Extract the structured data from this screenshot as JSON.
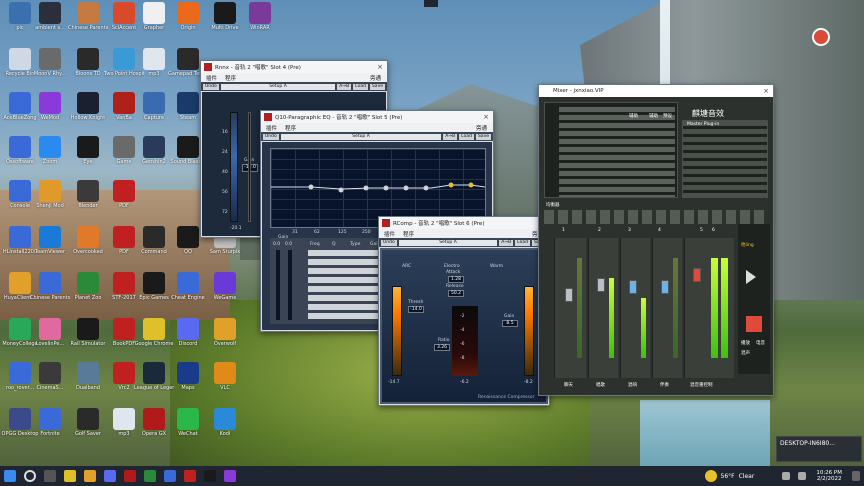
{
  "desktop": {
    "icons": [
      {
        "label": "pic",
        "color": "#3a6fb0",
        "col": 0,
        "row": 0
      },
      {
        "label": "ambient s...",
        "color": "#2b2f3a",
        "col": 1,
        "row": 0
      },
      {
        "label": "Chinese Parents",
        "color": "#c47a40",
        "col": 2,
        "row": 0
      },
      {
        "label": "SciAccent",
        "color": "#d84a2a",
        "col": 3,
        "row": 0
      },
      {
        "label": "Grapher",
        "color": "#f0f0f0",
        "col": 4,
        "row": 0
      },
      {
        "label": "Origin",
        "color": "#e86a1a",
        "col": 5,
        "row": 0
      },
      {
        "label": "Multi Drive",
        "color": "#1a1a1a",
        "col": 6,
        "row": 0
      },
      {
        "label": "WinRAR",
        "color": "#7a3a9a",
        "col": 7,
        "row": 0
      },
      {
        "label": "Recycle Bin",
        "color": "#cfd8e4",
        "col": 0,
        "row": 1
      },
      {
        "label": "MoonV Rhy...",
        "color": "#6a6a6a",
        "col": 1,
        "row": 1
      },
      {
        "label": "Bloons TD",
        "color": "#2a2a2a",
        "col": 2,
        "row": 1
      },
      {
        "label": "Two Point Hospital",
        "color": "#3a9ad8",
        "col": 3,
        "row": 1
      },
      {
        "label": "mp3",
        "color": "#e0e6ee",
        "col": 4,
        "row": 1
      },
      {
        "label": "Gamepad Tester",
        "color": "#2a2a2a",
        "col": 5,
        "row": 1
      },
      {
        "label": "AceBlueZong",
        "color": "#3a6ad8",
        "col": 0,
        "row": 2
      },
      {
        "label": "WeMod",
        "color": "#8a3ad8",
        "col": 1,
        "row": 2
      },
      {
        "label": "Hollow Knight",
        "color": "#1a2030",
        "col": 2,
        "row": 2
      },
      {
        "label": "VanBa",
        "color": "#b0201a",
        "col": 3,
        "row": 2
      },
      {
        "label": "Capture",
        "color": "#3a6ab0",
        "col": 4,
        "row": 2
      },
      {
        "label": "Steam",
        "color": "#1a3a6a",
        "col": 5,
        "row": 2
      },
      {
        "label": "Ossoftware",
        "color": "#3a6ad8",
        "col": 0,
        "row": 3
      },
      {
        "label": "Zoom",
        "color": "#2a8af0",
        "col": 1,
        "row": 3
      },
      {
        "label": "Eye",
        "color": "#1a1a1a",
        "col": 2,
        "row": 3
      },
      {
        "label": "Game",
        "color": "#6a6a6a",
        "col": 3,
        "row": 3
      },
      {
        "label": "Genshin2",
        "color": "#2a3a5a",
        "col": 4,
        "row": 3
      },
      {
        "label": "Sound Blaster",
        "color": "#1a1a1a",
        "col": 5,
        "row": 3
      },
      {
        "label": "Console",
        "color": "#3a6ad8",
        "col": 0,
        "row": 4
      },
      {
        "label": "Shenji Mod",
        "color": "#e09a2a",
        "col": 1,
        "row": 4
      },
      {
        "label": "Blender",
        "color": "#3a3a3a",
        "col": 2,
        "row": 4
      },
      {
        "label": "PDF",
        "color": "#c02020",
        "col": 3,
        "row": 4
      },
      {
        "label": "HLinstall2200",
        "color": "#3a6ad8",
        "col": 0,
        "row": 5
      },
      {
        "label": "TeamViewer",
        "color": "#1a7ad8",
        "col": 1,
        "row": 5
      },
      {
        "label": "Overcooked",
        "color": "#e07a2a",
        "col": 2,
        "row": 5
      },
      {
        "label": "PDF",
        "color": "#c02020",
        "col": 3,
        "row": 5
      },
      {
        "label": "Command",
        "color": "#2a2a2a",
        "col": 4,
        "row": 5
      },
      {
        "label": "QQ",
        "color": "#1a1a1a",
        "col": 5,
        "row": 5
      },
      {
        "label": "Sam Sturpik",
        "color": "#c0c0c0",
        "col": 6,
        "row": 5
      },
      {
        "label": "HuyaClient...",
        "color": "#e0a02a",
        "col": 0,
        "row": 6
      },
      {
        "label": "Chinese Parents Table",
        "color": "#3a6ad8",
        "col": 1,
        "row": 6
      },
      {
        "label": "Planet Zoo",
        "color": "#2a8a3a",
        "col": 2,
        "row": 6
      },
      {
        "label": "STF-2017",
        "color": "#c02020",
        "col": 3,
        "row": 6
      },
      {
        "label": "Epic Games",
        "color": "#1a1a1a",
        "col": 4,
        "row": 6
      },
      {
        "label": "Cheat Engine",
        "color": "#3a6ad8",
        "col": 5,
        "row": 6
      },
      {
        "label": "WeGame",
        "color": "#6a3ad8",
        "col": 6,
        "row": 6
      },
      {
        "label": "MoneyCollege",
        "color": "#2aa85a",
        "col": 0,
        "row": 7
      },
      {
        "label": "LovelinPe...",
        "color": "#e06aa0",
        "col": 1,
        "row": 7
      },
      {
        "label": "Rail Simulator",
        "color": "#1a1a1a",
        "col": 2,
        "row": 7
      },
      {
        "label": "BookPDF",
        "color": "#c02020",
        "col": 3,
        "row": 7
      },
      {
        "label": "Google Chrome",
        "color": "#e0c02a",
        "col": 4,
        "row": 7
      },
      {
        "label": "Discord",
        "color": "#5a6af0",
        "col": 5,
        "row": 7
      },
      {
        "label": "Overwolf",
        "color": "#e0a02a",
        "col": 6,
        "row": 7
      },
      {
        "label": "roo_rover...",
        "color": "#3a6ad8",
        "col": 0,
        "row": 8
      },
      {
        "label": "CinemaS...",
        "color": "#3a3a3a",
        "col": 1,
        "row": 8
      },
      {
        "label": "Dualband",
        "color": "#5a7a9a",
        "col": 2,
        "row": 8
      },
      {
        "label": "Vrc2",
        "color": "#c02020",
        "col": 3,
        "row": 8
      },
      {
        "label": "League of Legends",
        "color": "#1a2a3a",
        "col": 4,
        "row": 8
      },
      {
        "label": "Maps",
        "color": "#1a3a8a",
        "col": 5,
        "row": 8
      },
      {
        "label": "VLC",
        "color": "#e08a1a",
        "col": 6,
        "row": 8
      },
      {
        "label": "OPGG Desktop",
        "color": "#3a4a8a",
        "col": 0,
        "row": 9
      },
      {
        "label": "Fortnite",
        "color": "#3a6ad8",
        "col": 1,
        "row": 9
      },
      {
        "label": "Golf Saver",
        "color": "#2a2a2a",
        "col": 2,
        "row": 9
      },
      {
        "label": "mp3",
        "color": "#e0e6ee",
        "col": 3,
        "row": 9
      },
      {
        "label": "Opera GX",
        "color": "#b01a1a",
        "col": 4,
        "row": 9
      },
      {
        "label": "WeChat",
        "color": "#2ab84a",
        "col": 5,
        "row": 9
      },
      {
        "label": "Kodi",
        "color": "#2a8ad8",
        "col": 6,
        "row": 9
      }
    ]
  },
  "renaxx": {
    "title": "Rnnx - 音轨 2 \"唱歌\" Slot 4 (Pre)",
    "menu": [
      "插件",
      "程序"
    ],
    "bypass": "旁通",
    "undo": "Undo",
    "setup": "Setup A",
    "buttons": [
      "A→B",
      "Load",
      "Save",
      "?"
    ],
    "gain_label": "Gain",
    "gain_value": "-10.0",
    "ticks": [
      "16",
      "24",
      "40",
      "56",
      "72"
    ],
    "meter_value": "-20.1"
  },
  "q10": {
    "title": "Q10-Paragraphic EQ - 音轨 2 \"唱歌\" Slot 5 (Pre)",
    "menu": [
      "插件",
      "程序"
    ],
    "bypass": "旁通",
    "undo": "Undo",
    "setup": "Setup A",
    "buttons": [
      "A→B",
      "Load",
      "Save",
      "?"
    ],
    "gain_label": "Gain",
    "freq_labels": [
      "31",
      "62",
      "125",
      "250",
      "500",
      "1K"
    ],
    "bottom": {
      "cols": [
        "Gain",
        "Freq",
        "Q",
        "Type",
        "Gain"
      ]
    },
    "fader_values": [
      "0.0",
      "0.0"
    ]
  },
  "rcomp": {
    "title": "RComp - 音轨 2 \"唱歌\" Slot 6 (Pre)",
    "menu": [
      "插件",
      "程序"
    ],
    "bypass": "旁通",
    "undo": "Undo",
    "setup": "Setup A",
    "buttons": [
      "A→B",
      "Load",
      "Save",
      "?"
    ],
    "labels": {
      "arc": "ARC",
      "electro": "Electro",
      "warm": "Warm",
      "attack": "Attack",
      "release": "Release",
      "thresh": "Thresh",
      "ratio": "Ratio",
      "gain": "Gain"
    },
    "values": {
      "attack": "1.28",
      "release": "50.2",
      "thresh": "-14.0",
      "ratio": "3.26",
      "gain": "8.5"
    },
    "gr_scale": [
      "-2",
      "-4",
      "-6",
      "-8"
    ],
    "left_meter": "-14.7",
    "right_meter": "-8.2",
    "mid_meter": "-6.2",
    "brand": "Renaissance Compressor"
  },
  "mixer": {
    "title": "Mixer - jxnxiao.VIP",
    "header": "麒塘音效",
    "routing_labels": [
      "辅助",
      "辅助",
      "预设",
      "Master Plug-in"
    ],
    "channel_names": [
      "聊天",
      "唱歌",
      "混响",
      "伴奏",
      "混音重控制"
    ],
    "channel_nums": [
      "1",
      "2",
      "3",
      "4",
      "5",
      "6"
    ],
    "inserts_header": "均衡器",
    "side_buttons": [
      "插件"
    ],
    "right_buttons": [
      "播放",
      "电音",
      "混声"
    ],
    "right_labels": [
      "他ling"
    ],
    "accent": "#7ac23a"
  },
  "taskbar": {
    "weather_temp": "56°F",
    "weather": "Clear",
    "time": "10:26 PM",
    "date": "2/2/2022",
    "notification": "DESKTOP-IN6I80..."
  }
}
